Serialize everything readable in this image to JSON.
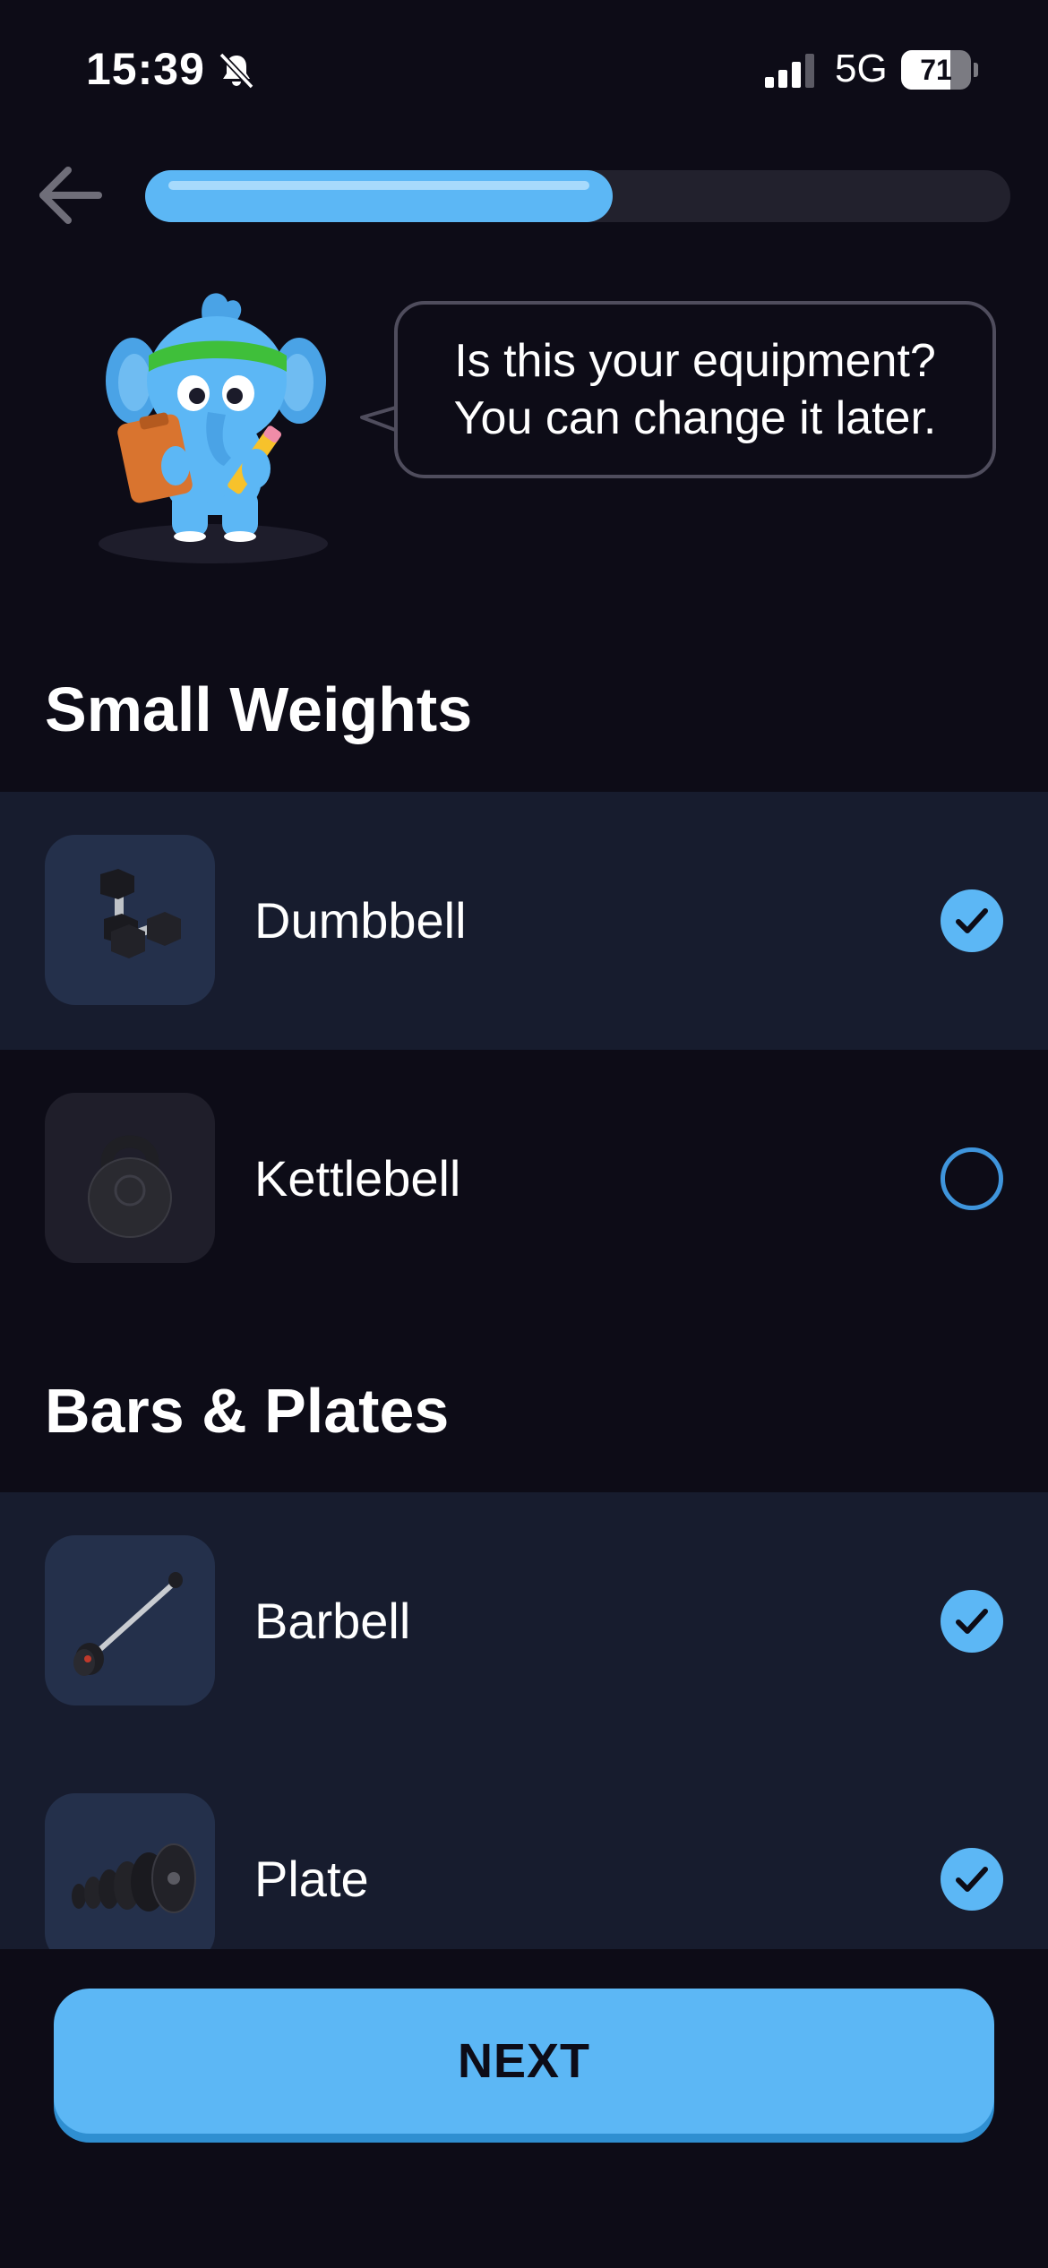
{
  "status_bar": {
    "time": "15:39",
    "network": "5G",
    "battery_percent": "71",
    "battery_level": 0.71,
    "icons": [
      "bell-slash-icon",
      "signal-icon",
      "battery-icon"
    ]
  },
  "header": {
    "back_icon": "arrow-left-icon",
    "progress": 0.54
  },
  "mascot": {
    "icon": "elephant-mascot",
    "speech": {
      "line1": "Is this your equipment?",
      "line2": "You can change it later."
    }
  },
  "sections": [
    {
      "title": "Small Weights",
      "items": [
        {
          "label": "Dumbbell",
          "icon": "dumbbell-icon",
          "selected": true
        },
        {
          "label": "Kettlebell",
          "icon": "kettlebell-icon",
          "selected": false
        }
      ]
    },
    {
      "title": "Bars & Plates",
      "items": [
        {
          "label": "Barbell",
          "icon": "barbell-icon",
          "selected": true
        },
        {
          "label": "Plate",
          "icon": "plate-icon",
          "selected": true
        }
      ]
    }
  ],
  "footer": {
    "next_label": "NEXT"
  },
  "colors": {
    "background": "#0d0c17",
    "accent": "#5cb7f5",
    "selected_row": "#171c2e",
    "progress_track": "#22212d"
  }
}
